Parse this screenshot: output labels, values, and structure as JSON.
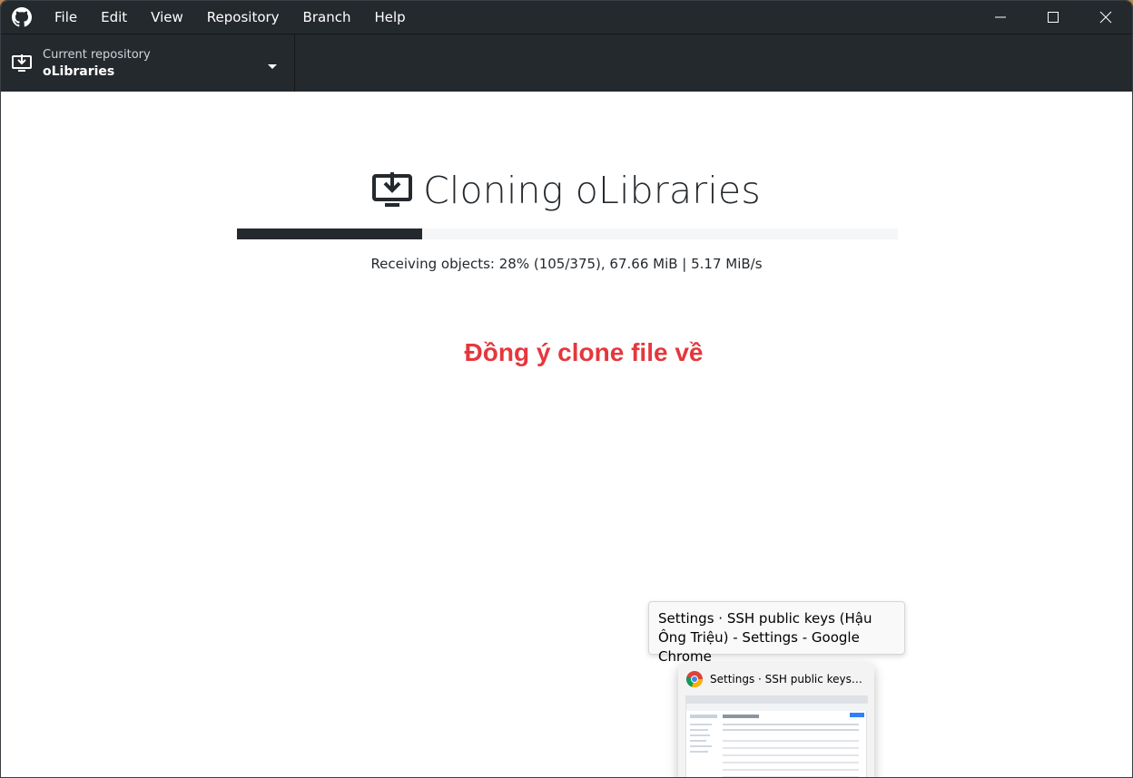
{
  "menu": {
    "items": [
      "File",
      "Edit",
      "View",
      "Repository",
      "Branch",
      "Help"
    ]
  },
  "toolbar": {
    "repo_label": "Current repository",
    "repo_name": "oLibraries"
  },
  "clone": {
    "title": "Cloning oLibraries",
    "progress": 0.28,
    "status": "Receiving objects: 28% (105/375), 67.66 MiB | 5.17 MiB/s"
  },
  "annotation": "Đồng ý clone file về",
  "taskbar": {
    "tooltip": "Settings · SSH public keys (Hậu Ông Triệu) - Settings - Google Chrome",
    "preview_title": "Settings · SSH public keys (Hậu Ông Triệu) - Settings - Google Chrome"
  },
  "colors": {
    "titlebar": "#24292e",
    "accent_text": "#e5373d"
  }
}
